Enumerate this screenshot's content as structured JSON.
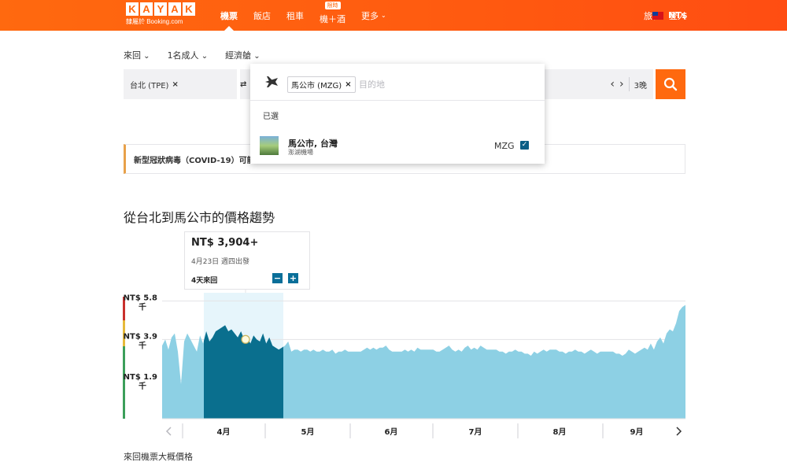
{
  "header": {
    "logo_letters": [
      "K",
      "A",
      "Y",
      "A",
      "K"
    ],
    "logo_sub": "隸屬於 Booking.com",
    "nav": [
      {
        "label": "機票",
        "active": true
      },
      {
        "label": "飯店",
        "active": false
      },
      {
        "label": "租車",
        "active": false
      },
      {
        "label": "機＋酒",
        "badge": "限時",
        "active": false
      },
      {
        "label": "更多",
        "active": false,
        "has_caret": true
      }
    ],
    "trips": "旅程",
    "login": "登入",
    "currency": "NT$",
    "brand_color": "#ff690f"
  },
  "search": {
    "trip_type": "來回",
    "travelers": "1名成人",
    "cabin": "經濟艙",
    "origin": "台北 (TPE)",
    "swap_glyph": "⇄",
    "dates_prev": "‹",
    "dates_next": "›",
    "nights": "3晚"
  },
  "dropdown": {
    "chip": "馬公市 (MZG)",
    "placeholder": "目的地",
    "section": "已選",
    "city": "馬公市, 台灣",
    "airport": "澎湖機場",
    "code": "MZG"
  },
  "notice": {
    "text": "新型冠狀病毒（COVID-19）可能"
  },
  "trend": {
    "title": "從台北到馬公市的價格趨勢",
    "tooltip_price": "NT$ 3,904+",
    "tooltip_date": "4月23日 週四出發",
    "tooltip_duration": "4天來回",
    "minus": "−",
    "plus": "+",
    "footnote": "來回機票大概價格"
  },
  "chart_data": {
    "type": "area",
    "y_ticks": [
      {
        "line1": "NT$ 5.8",
        "line2": "千",
        "value": 5.8
      },
      {
        "line1": "NT$ 3.9",
        "line2": "千",
        "value": 3.9
      },
      {
        "line1": "NT$ 1.9",
        "line2": "千",
        "value": 1.9
      }
    ],
    "x_labels": [
      "4月",
      "5月",
      "6月",
      "7月",
      "8月",
      "9月"
    ],
    "ylim": [
      0,
      6.2
    ],
    "selected_start": "4月23日",
    "selected_days": 4,
    "selected_price": 3.904,
    "series": [
      {
        "values": [
          3.6,
          3.9,
          3.4,
          4.0,
          4.2,
          3.3,
          1.7,
          3.8,
          4.2,
          3.9,
          3.6,
          3.3,
          4.1,
          3.7,
          4.3,
          3.8,
          4.0,
          4.3,
          4.4,
          4.5,
          4.6,
          4.3,
          4.4,
          4.2,
          4.0,
          4.3,
          3.9,
          4.0,
          3.7,
          4.1,
          3.9,
          3.8,
          4.2,
          3.7,
          4.0,
          3.6,
          3.5,
          3.4,
          3.5,
          3.6,
          3.8,
          3.3,
          3.4,
          3.4,
          3.3,
          3.4,
          3.4,
          3.3,
          3.4,
          3.3,
          3.3,
          3.4,
          3.3,
          3.3,
          3.4,
          3.2,
          3.3,
          3.3,
          3.4,
          3.3,
          3.3,
          3.3,
          3.3,
          3.3,
          3.4,
          3.5,
          3.4,
          3.5,
          3.4,
          3.5,
          3.5,
          3.6,
          3.4,
          3.3,
          3.3,
          3.3,
          3.3,
          3.4,
          3.3,
          3.4,
          3.3,
          3.5,
          3.4,
          3.4,
          3.4,
          3.4,
          3.4,
          3.3,
          3.3,
          3.4,
          3.5,
          3.6,
          3.4,
          3.3,
          3.4,
          3.3,
          3.5,
          3.6,
          3.4,
          3.5,
          3.4,
          3.6,
          3.5,
          3.4,
          3.4,
          3.4,
          3.4,
          3.3,
          3.3,
          3.2,
          3.3,
          3.3,
          3.4,
          3.3,
          3.3,
          3.2,
          3.2,
          3.1,
          3.3,
          3.2,
          3.3,
          3.4,
          3.3,
          3.4,
          3.4,
          3.4,
          3.3,
          3.3,
          3.2,
          3.3,
          3.3,
          3.4,
          3.3,
          3.3,
          3.2,
          3.3,
          3.4,
          3.3,
          3.2,
          3.3,
          3.3,
          3.3,
          3.3,
          3.3,
          3.2,
          3.2,
          3.1,
          3.2,
          3.4,
          3.3,
          3.2,
          3.3,
          3.4,
          3.5,
          3.4,
          3.7,
          3.4,
          3.8,
          4.0,
          3.7,
          4.2,
          4.4,
          4.3,
          4.7,
          5.3,
          5.5,
          5.6
        ]
      }
    ],
    "colors": {
      "area": "#8dd0e4",
      "selected": "#0a6f8e",
      "highlight": "#e6f5fb",
      "scale_red": "#c9302c",
      "scale_yellow": "#e6b93a",
      "scale_green": "#3c9f5a"
    }
  }
}
